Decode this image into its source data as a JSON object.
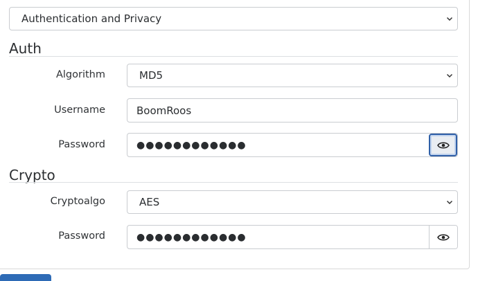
{
  "top_select": {
    "value": "Authentication and Privacy"
  },
  "auth": {
    "title": "Auth",
    "algorithm": {
      "label": "Algorithm",
      "value": "MD5"
    },
    "username": {
      "label": "Username",
      "value": "BoomRoos"
    },
    "password": {
      "label": "Password",
      "value": "●●●●●●●●●●●●"
    }
  },
  "crypto": {
    "title": "Crypto",
    "cryptoalgo": {
      "label": "Cryptoalgo",
      "value": "AES"
    },
    "password": {
      "label": "Password",
      "value": "●●●●●●●●●●●●"
    }
  },
  "icons": {
    "toggle_visibility": "eye-icon",
    "dropdown": "chevron-down-icon"
  },
  "colors": {
    "active_button_border": "#2f5fa7",
    "primary": "#2e6bb6"
  }
}
